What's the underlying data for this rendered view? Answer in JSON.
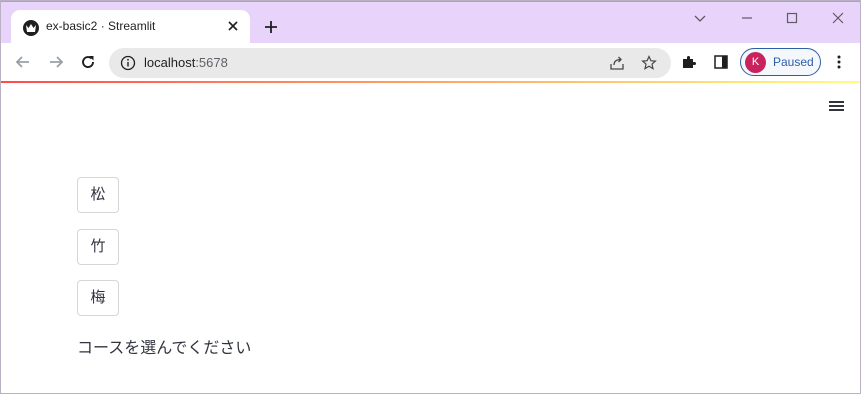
{
  "browser": {
    "tab": {
      "title": "ex-basic2 · Streamlit",
      "favicon": "streamlit-crown-icon"
    },
    "address_bar": {
      "host": "localhost",
      "port": ":5678"
    },
    "profile": {
      "initial": "K",
      "status": "Paused",
      "avatar_color": "#c8235e"
    },
    "colors": {
      "tabstrip": "#e8d4fa",
      "profile_accent": "#2d5ea8"
    }
  },
  "app": {
    "buttons": [
      {
        "label": "松"
      },
      {
        "label": "竹"
      },
      {
        "label": "梅"
      }
    ],
    "message": "コースを選んでください",
    "colors": {
      "text": "#31333f",
      "decoration_start": "#ff4b4b",
      "decoration_end": "#fffd80"
    }
  }
}
